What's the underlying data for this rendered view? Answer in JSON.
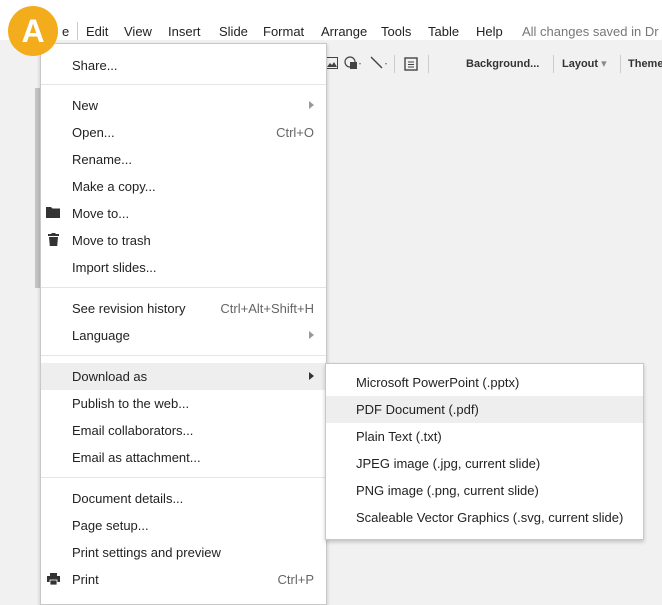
{
  "badge": {
    "letter": "A",
    "color": "#f2ac1c"
  },
  "menubar": {
    "items": [
      "e",
      "Edit",
      "View",
      "Insert",
      "Slide",
      "Format",
      "Arrange",
      "Tools",
      "Table",
      "Help"
    ],
    "status": "All changes saved in Dr"
  },
  "toolbar": {
    "background_label": "Background...",
    "layout_label": "Layout",
    "theme_label": "Theme"
  },
  "file_menu": {
    "share": "Share...",
    "new": "New",
    "open": "Open...",
    "open_shortcut": "Ctrl+O",
    "rename": "Rename...",
    "make_copy": "Make a copy...",
    "move_to": "Move to...",
    "move_to_trash": "Move to trash",
    "import_slides": "Import slides...",
    "revision_history": "See revision history",
    "revision_shortcut": "Ctrl+Alt+Shift+H",
    "language": "Language",
    "download_as": "Download as",
    "publish": "Publish to the web...",
    "email_collaborators": "Email collaborators...",
    "email_attachment": "Email as attachment...",
    "document_details": "Document details...",
    "page_setup": "Page setup...",
    "print_settings": "Print settings and preview",
    "print": "Print",
    "print_shortcut": "Ctrl+P"
  },
  "download_submenu": {
    "items": [
      "Microsoft PowerPoint (.pptx)",
      "PDF Document (.pdf)",
      "Plain Text (.txt)",
      "JPEG image (.jpg, current slide)",
      "PNG image (.png, current slide)",
      "Scaleable Vector Graphics (.svg, current slide)"
    ],
    "highlighted_index": 1
  }
}
